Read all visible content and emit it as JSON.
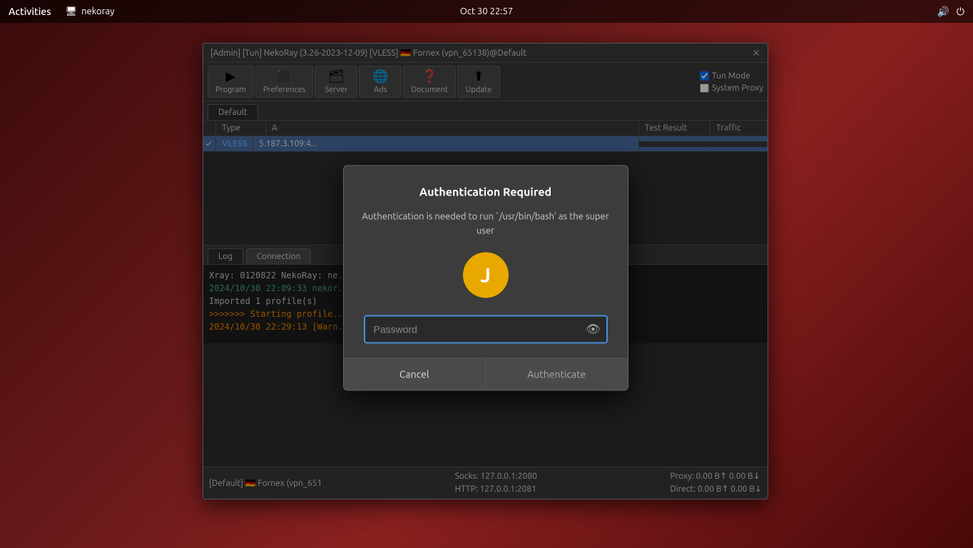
{
  "topbar": {
    "activities_label": "Activities",
    "app_icon": "🖥",
    "app_name": "nekoray",
    "datetime": "Oct 30  22:57",
    "volume_icon": "🔊",
    "power_icon": "⏻"
  },
  "window": {
    "title": "[Admin] [Tun] NekoRay (3.26-2023-12-09) [VLESS] 🇩🇪 Fornex (vpn_65138)@Default",
    "close_label": "✕",
    "toolbar": {
      "program_label": "Program",
      "preferences_label": "Preferences",
      "server_label": "Server",
      "ads_label": "Ads",
      "document_label": "Document",
      "update_label": "Update",
      "tun_mode_label": "Tun Mode",
      "system_proxy_label": "System Proxy"
    },
    "tab": {
      "default_label": "Default"
    },
    "table": {
      "col_type": "Type",
      "col_addr": "A",
      "col_test": "Test Result",
      "col_traffic": "Traffic",
      "rows": [
        {
          "checked": "✓",
          "type": "VLESS",
          "addr": "5.187.3.109:4...",
          "test": "",
          "traffic": ""
        }
      ]
    },
    "log_tabs": {
      "log_label": "Log",
      "connection_label": "Connection"
    },
    "log_lines": [
      {
        "text": "Xray: 0120822 NekoRay: ne...",
        "style": "normal"
      },
      {
        "text": "2024/10/30 22:09:33 nekor...",
        "style": "green"
      },
      {
        "text": "Imported 1 profile(s)",
        "style": "normal"
      },
      {
        "text": ">>>>>>> Starting profile...",
        "style": "orange"
      },
      {
        "text": "2024/10/30 22:29:13 [Warn...",
        "style": "warn"
      }
    ],
    "statusbar": {
      "profile": "[Default] 🇩🇪 Fornex (vpn_651",
      "socks": "Socks: 127.0.0.1:2080",
      "http": "HTTP: 127.0.0.1:2081",
      "proxy_stats": "Proxy: 0.00 B↑ 0.00 B↓",
      "direct_stats": "Direct: 0.00 B↑ 0.00 B↓"
    }
  },
  "auth_dialog": {
    "title": "Authentication Required",
    "message": "Authentication is needed to run `/usr/bin/bash' as the super user",
    "avatar_letter": "J",
    "password_placeholder": "Password",
    "eye_icon": "👁",
    "cancel_label": "Cancel",
    "authenticate_label": "Authenticate"
  }
}
